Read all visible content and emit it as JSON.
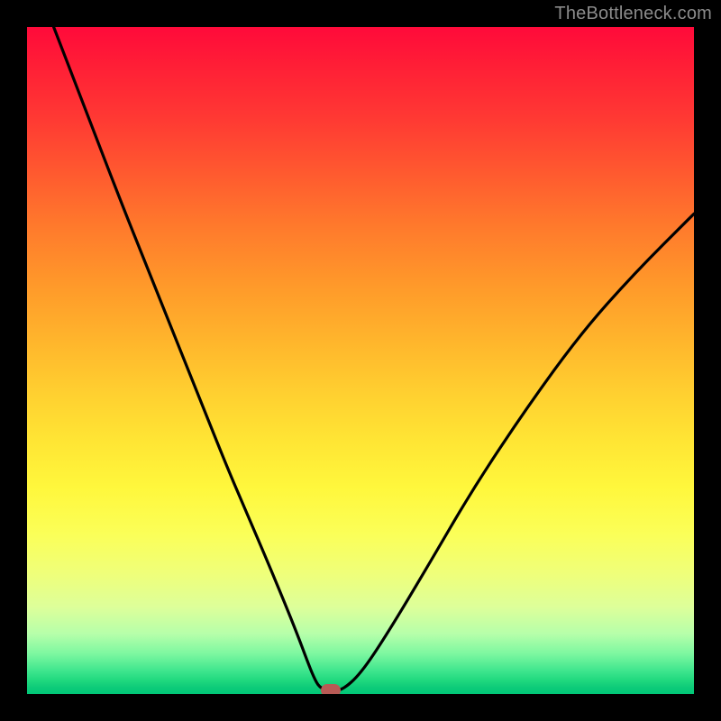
{
  "watermark": "TheBottleneck.com",
  "chart_data": {
    "type": "line",
    "title": "",
    "xlabel": "",
    "ylabel": "",
    "xlim": [
      0,
      1
    ],
    "ylim": [
      0,
      1
    ],
    "legend": false,
    "grid": false,
    "background_gradient": {
      "direction": "vertical",
      "stops": [
        {
          "pos": 0.0,
          "color": "#ff0a3a"
        },
        {
          "pos": 0.5,
          "color": "#ffb52c"
        },
        {
          "pos": 0.75,
          "color": "#fbff58"
        },
        {
          "pos": 0.9,
          "color": "#b6ffaa"
        },
        {
          "pos": 1.0,
          "color": "#00c878"
        }
      ]
    },
    "series": [
      {
        "name": "bottleneck-curve",
        "x": [
          0.04,
          0.09,
          0.14,
          0.18,
          0.22,
          0.26,
          0.3,
          0.33,
          0.36,
          0.385,
          0.405,
          0.42,
          0.43,
          0.438,
          0.452,
          0.472,
          0.5,
          0.54,
          0.6,
          0.67,
          0.75,
          0.83,
          0.91,
          1.0
        ],
        "y": [
          1.0,
          0.87,
          0.74,
          0.64,
          0.54,
          0.44,
          0.34,
          0.27,
          0.2,
          0.14,
          0.09,
          0.05,
          0.025,
          0.01,
          0.005,
          0.005,
          0.03,
          0.09,
          0.19,
          0.31,
          0.43,
          0.54,
          0.63,
          0.72
        ]
      }
    ],
    "marker": {
      "x": 0.455,
      "y": 0.005,
      "color": "#b85a55",
      "shape": "pill"
    }
  }
}
